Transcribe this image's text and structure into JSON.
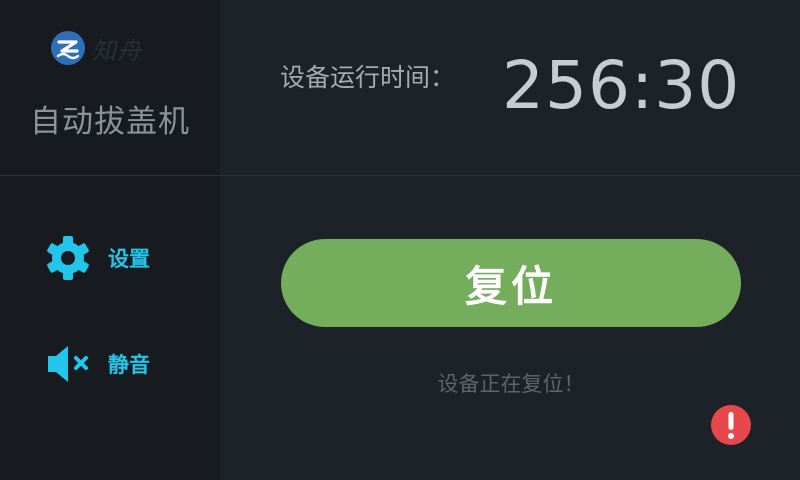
{
  "sidebar": {
    "logo_text": "知舟",
    "app_title": "自动拔盖机",
    "items": [
      {
        "label": "设置",
        "icon": "gear-icon"
      },
      {
        "label": "静音",
        "icon": "speaker-muted-icon"
      }
    ]
  },
  "main": {
    "runtime_label": "设备运行时间：",
    "runtime_value": "256:30",
    "reset_label": "复位",
    "status_text": "设备正在复位！"
  },
  "colors": {
    "accent": "#22c6ea",
    "button": "#74ad5b",
    "alert": "#e8474c",
    "logo": "#2f6fb5"
  }
}
